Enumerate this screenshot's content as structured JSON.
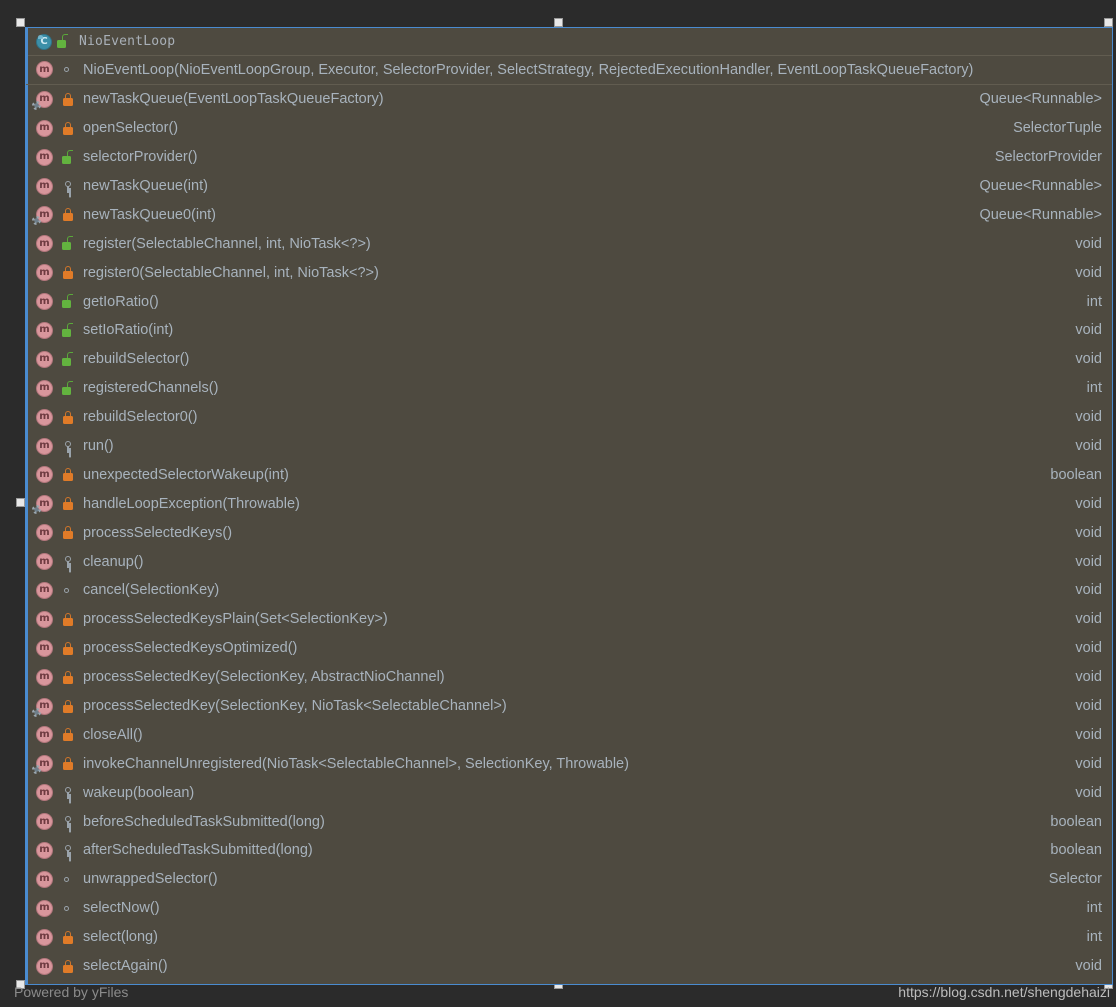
{
  "colors": {
    "canvas_background": "#2b2b2b",
    "node_background": "#4e4a40",
    "selection_border": "#4a8bd0",
    "text": "#a8b3bd",
    "separator": "#615c50",
    "class_icon": "#3c8fa8",
    "method_icon": "#d8969c",
    "private_lock": "#e07b28",
    "protected_lock": "#63b33f",
    "package_key": "#9aa3ab"
  },
  "node": {
    "class_name": "NioEventLoop",
    "class_icon": "class-icon",
    "class_visibility_icon": "unlocked-padlock-icon",
    "members": [
      {
        "icon": "method-icon",
        "visibility": "public",
        "cog": false,
        "signature": "NioEventLoop(NioEventLoopGroup, Executor, SelectorProvider, SelectStrategy, RejectedExecutionHandler, EventLoopTaskQueueFactory)",
        "return_type": ""
      },
      {
        "icon": "method-icon",
        "visibility": "private",
        "cog": true,
        "signature": "newTaskQueue(EventLoopTaskQueueFactory)",
        "return_type": "Queue<Runnable>"
      },
      {
        "icon": "method-icon",
        "visibility": "private",
        "cog": false,
        "signature": "openSelector()",
        "return_type": "SelectorTuple"
      },
      {
        "icon": "method-icon",
        "visibility": "protected",
        "cog": false,
        "signature": "selectorProvider()",
        "return_type": "SelectorProvider"
      },
      {
        "icon": "method-icon",
        "visibility": "package",
        "cog": false,
        "signature": "newTaskQueue(int)",
        "return_type": "Queue<Runnable>"
      },
      {
        "icon": "method-icon",
        "visibility": "private",
        "cog": true,
        "signature": "newTaskQueue0(int)",
        "return_type": "Queue<Runnable>"
      },
      {
        "icon": "method-icon",
        "visibility": "protected",
        "cog": false,
        "signature": "register(SelectableChannel, int, NioTask<?>)",
        "return_type": "void"
      },
      {
        "icon": "method-icon",
        "visibility": "private",
        "cog": false,
        "signature": "register0(SelectableChannel, int, NioTask<?>)",
        "return_type": "void"
      },
      {
        "icon": "method-icon",
        "visibility": "protected",
        "cog": false,
        "signature": "getIoRatio()",
        "return_type": "int"
      },
      {
        "icon": "method-icon",
        "visibility": "protected",
        "cog": false,
        "signature": "setIoRatio(int)",
        "return_type": "void"
      },
      {
        "icon": "method-icon",
        "visibility": "protected",
        "cog": false,
        "signature": "rebuildSelector()",
        "return_type": "void"
      },
      {
        "icon": "method-icon",
        "visibility": "protected",
        "cog": false,
        "signature": "registeredChannels()",
        "return_type": "int"
      },
      {
        "icon": "method-icon",
        "visibility": "private",
        "cog": false,
        "signature": "rebuildSelector0()",
        "return_type": "void"
      },
      {
        "icon": "method-icon",
        "visibility": "package",
        "cog": false,
        "signature": "run()",
        "return_type": "void"
      },
      {
        "icon": "method-icon",
        "visibility": "private",
        "cog": false,
        "signature": "unexpectedSelectorWakeup(int)",
        "return_type": "boolean"
      },
      {
        "icon": "method-icon",
        "visibility": "private",
        "cog": true,
        "signature": "handleLoopException(Throwable)",
        "return_type": "void"
      },
      {
        "icon": "method-icon",
        "visibility": "private",
        "cog": false,
        "signature": "processSelectedKeys()",
        "return_type": "void"
      },
      {
        "icon": "method-icon",
        "visibility": "package",
        "cog": false,
        "signature": "cleanup()",
        "return_type": "void"
      },
      {
        "icon": "method-icon",
        "visibility": "public",
        "cog": false,
        "signature": "cancel(SelectionKey)",
        "return_type": "void"
      },
      {
        "icon": "method-icon",
        "visibility": "private",
        "cog": false,
        "signature": "processSelectedKeysPlain(Set<SelectionKey>)",
        "return_type": "void"
      },
      {
        "icon": "method-icon",
        "visibility": "private",
        "cog": false,
        "signature": "processSelectedKeysOptimized()",
        "return_type": "void"
      },
      {
        "icon": "method-icon",
        "visibility": "private",
        "cog": false,
        "signature": "processSelectedKey(SelectionKey, AbstractNioChannel)",
        "return_type": "void"
      },
      {
        "icon": "method-icon",
        "visibility": "private",
        "cog": true,
        "signature": "processSelectedKey(SelectionKey, NioTask<SelectableChannel>)",
        "return_type": "void"
      },
      {
        "icon": "method-icon",
        "visibility": "private",
        "cog": false,
        "signature": "closeAll()",
        "return_type": "void"
      },
      {
        "icon": "method-icon",
        "visibility": "private",
        "cog": true,
        "signature": "invokeChannelUnregistered(NioTask<SelectableChannel>, SelectionKey, Throwable)",
        "return_type": "void"
      },
      {
        "icon": "method-icon",
        "visibility": "package",
        "cog": false,
        "signature": "wakeup(boolean)",
        "return_type": "void"
      },
      {
        "icon": "method-icon",
        "visibility": "package",
        "cog": false,
        "signature": "beforeScheduledTaskSubmitted(long)",
        "return_type": "boolean"
      },
      {
        "icon": "method-icon",
        "visibility": "package",
        "cog": false,
        "signature": "afterScheduledTaskSubmitted(long)",
        "return_type": "boolean"
      },
      {
        "icon": "method-icon",
        "visibility": "public",
        "cog": false,
        "signature": "unwrappedSelector()",
        "return_type": "Selector"
      },
      {
        "icon": "method-icon",
        "visibility": "public",
        "cog": false,
        "signature": "selectNow()",
        "return_type": "int"
      },
      {
        "icon": "method-icon",
        "visibility": "private",
        "cog": false,
        "signature": "select(long)",
        "return_type": "int"
      },
      {
        "icon": "method-icon",
        "visibility": "private",
        "cog": false,
        "signature": "selectAgain()",
        "return_type": "void"
      }
    ]
  },
  "footer": {
    "powered_by": "Powered by yFiles",
    "watermark": "https://blog.csdn.net/shengdehaizi"
  }
}
